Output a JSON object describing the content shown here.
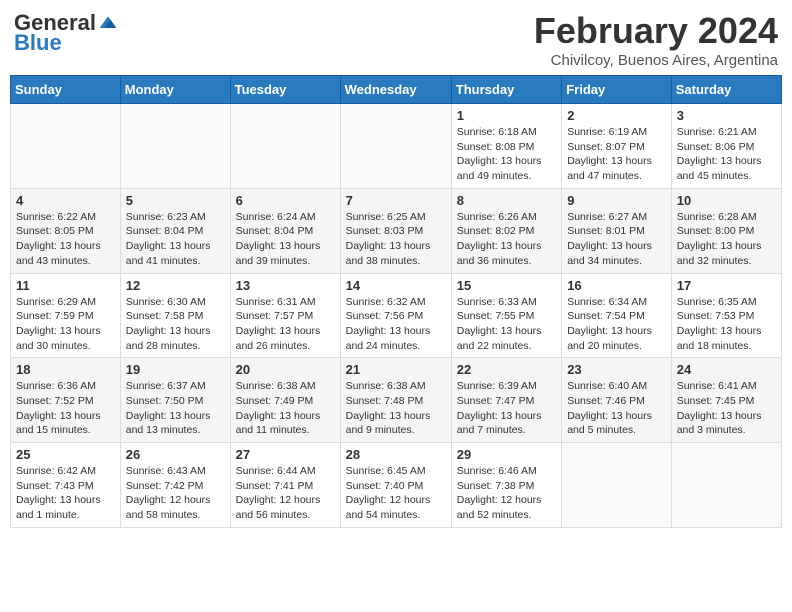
{
  "header": {
    "logo_general": "General",
    "logo_blue": "Blue",
    "month_title": "February 2024",
    "subtitle": "Chivilcoy, Buenos Aires, Argentina"
  },
  "days_of_week": [
    "Sunday",
    "Monday",
    "Tuesday",
    "Wednesday",
    "Thursday",
    "Friday",
    "Saturday"
  ],
  "weeks": [
    [
      {
        "num": "",
        "info": ""
      },
      {
        "num": "",
        "info": ""
      },
      {
        "num": "",
        "info": ""
      },
      {
        "num": "",
        "info": ""
      },
      {
        "num": "1",
        "info": "Sunrise: 6:18 AM\nSunset: 8:08 PM\nDaylight: 13 hours and 49 minutes."
      },
      {
        "num": "2",
        "info": "Sunrise: 6:19 AM\nSunset: 8:07 PM\nDaylight: 13 hours and 47 minutes."
      },
      {
        "num": "3",
        "info": "Sunrise: 6:21 AM\nSunset: 8:06 PM\nDaylight: 13 hours and 45 minutes."
      }
    ],
    [
      {
        "num": "4",
        "info": "Sunrise: 6:22 AM\nSunset: 8:05 PM\nDaylight: 13 hours and 43 minutes."
      },
      {
        "num": "5",
        "info": "Sunrise: 6:23 AM\nSunset: 8:04 PM\nDaylight: 13 hours and 41 minutes."
      },
      {
        "num": "6",
        "info": "Sunrise: 6:24 AM\nSunset: 8:04 PM\nDaylight: 13 hours and 39 minutes."
      },
      {
        "num": "7",
        "info": "Sunrise: 6:25 AM\nSunset: 8:03 PM\nDaylight: 13 hours and 38 minutes."
      },
      {
        "num": "8",
        "info": "Sunrise: 6:26 AM\nSunset: 8:02 PM\nDaylight: 13 hours and 36 minutes."
      },
      {
        "num": "9",
        "info": "Sunrise: 6:27 AM\nSunset: 8:01 PM\nDaylight: 13 hours and 34 minutes."
      },
      {
        "num": "10",
        "info": "Sunrise: 6:28 AM\nSunset: 8:00 PM\nDaylight: 13 hours and 32 minutes."
      }
    ],
    [
      {
        "num": "11",
        "info": "Sunrise: 6:29 AM\nSunset: 7:59 PM\nDaylight: 13 hours and 30 minutes."
      },
      {
        "num": "12",
        "info": "Sunrise: 6:30 AM\nSunset: 7:58 PM\nDaylight: 13 hours and 28 minutes."
      },
      {
        "num": "13",
        "info": "Sunrise: 6:31 AM\nSunset: 7:57 PM\nDaylight: 13 hours and 26 minutes."
      },
      {
        "num": "14",
        "info": "Sunrise: 6:32 AM\nSunset: 7:56 PM\nDaylight: 13 hours and 24 minutes."
      },
      {
        "num": "15",
        "info": "Sunrise: 6:33 AM\nSunset: 7:55 PM\nDaylight: 13 hours and 22 minutes."
      },
      {
        "num": "16",
        "info": "Sunrise: 6:34 AM\nSunset: 7:54 PM\nDaylight: 13 hours and 20 minutes."
      },
      {
        "num": "17",
        "info": "Sunrise: 6:35 AM\nSunset: 7:53 PM\nDaylight: 13 hours and 18 minutes."
      }
    ],
    [
      {
        "num": "18",
        "info": "Sunrise: 6:36 AM\nSunset: 7:52 PM\nDaylight: 13 hours and 15 minutes."
      },
      {
        "num": "19",
        "info": "Sunrise: 6:37 AM\nSunset: 7:50 PM\nDaylight: 13 hours and 13 minutes."
      },
      {
        "num": "20",
        "info": "Sunrise: 6:38 AM\nSunset: 7:49 PM\nDaylight: 13 hours and 11 minutes."
      },
      {
        "num": "21",
        "info": "Sunrise: 6:38 AM\nSunset: 7:48 PM\nDaylight: 13 hours and 9 minutes."
      },
      {
        "num": "22",
        "info": "Sunrise: 6:39 AM\nSunset: 7:47 PM\nDaylight: 13 hours and 7 minutes."
      },
      {
        "num": "23",
        "info": "Sunrise: 6:40 AM\nSunset: 7:46 PM\nDaylight: 13 hours and 5 minutes."
      },
      {
        "num": "24",
        "info": "Sunrise: 6:41 AM\nSunset: 7:45 PM\nDaylight: 13 hours and 3 minutes."
      }
    ],
    [
      {
        "num": "25",
        "info": "Sunrise: 6:42 AM\nSunset: 7:43 PM\nDaylight: 13 hours and 1 minute."
      },
      {
        "num": "26",
        "info": "Sunrise: 6:43 AM\nSunset: 7:42 PM\nDaylight: 12 hours and 58 minutes."
      },
      {
        "num": "27",
        "info": "Sunrise: 6:44 AM\nSunset: 7:41 PM\nDaylight: 12 hours and 56 minutes."
      },
      {
        "num": "28",
        "info": "Sunrise: 6:45 AM\nSunset: 7:40 PM\nDaylight: 12 hours and 54 minutes."
      },
      {
        "num": "29",
        "info": "Sunrise: 6:46 AM\nSunset: 7:38 PM\nDaylight: 12 hours and 52 minutes."
      },
      {
        "num": "",
        "info": ""
      },
      {
        "num": "",
        "info": ""
      }
    ]
  ]
}
